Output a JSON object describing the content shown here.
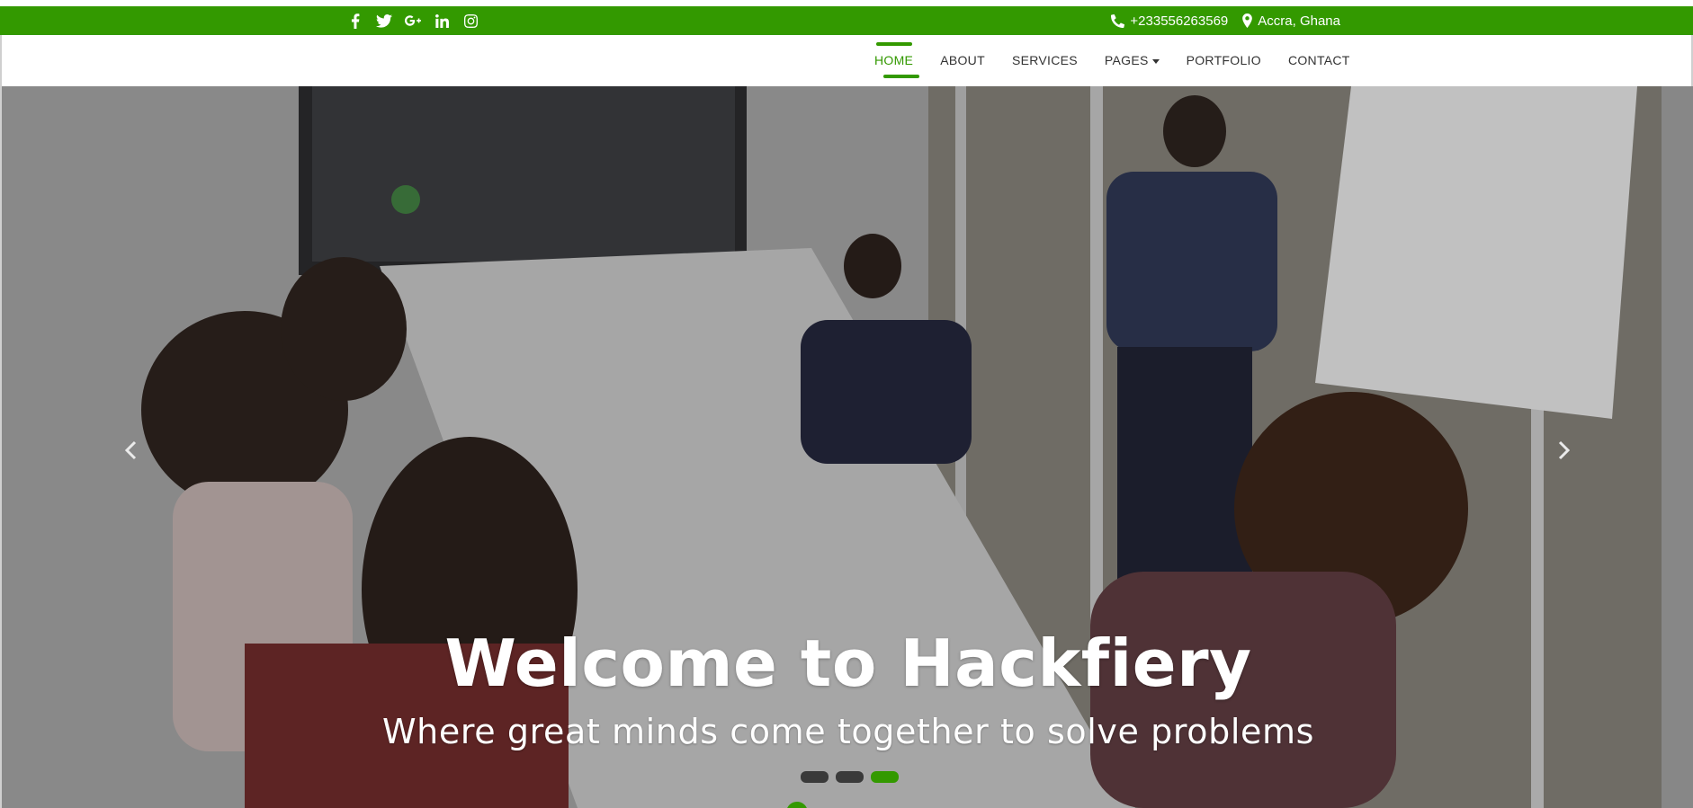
{
  "topbar": {
    "social": [
      {
        "name": "facebook-icon",
        "label": "Facebook"
      },
      {
        "name": "twitter-icon",
        "label": "Twitter"
      },
      {
        "name": "google-plus-icon",
        "label": "Google+"
      },
      {
        "name": "linkedin-icon",
        "label": "LinkedIn"
      },
      {
        "name": "instagram-icon",
        "label": "Instagram"
      }
    ],
    "phone": "+233556263569",
    "location": "Accra, Ghana",
    "background": "#339900"
  },
  "nav": {
    "items": [
      {
        "label": "HOME",
        "active": true
      },
      {
        "label": "ABOUT",
        "active": false
      },
      {
        "label": "SERVICES",
        "active": false
      },
      {
        "label": "PAGES",
        "active": false,
        "dropdown": true
      },
      {
        "label": "PORTFOLIO",
        "active": false
      },
      {
        "label": "CONTACT",
        "active": false
      }
    ],
    "accent": "#339900"
  },
  "hero": {
    "title": "Welcome to Hackfiery",
    "subtitle": "Where great minds come together to solve problems",
    "slides_total": 3,
    "active_slide": 3,
    "prev_icon": "chevron-left-icon",
    "next_icon": "chevron-right-icon"
  }
}
